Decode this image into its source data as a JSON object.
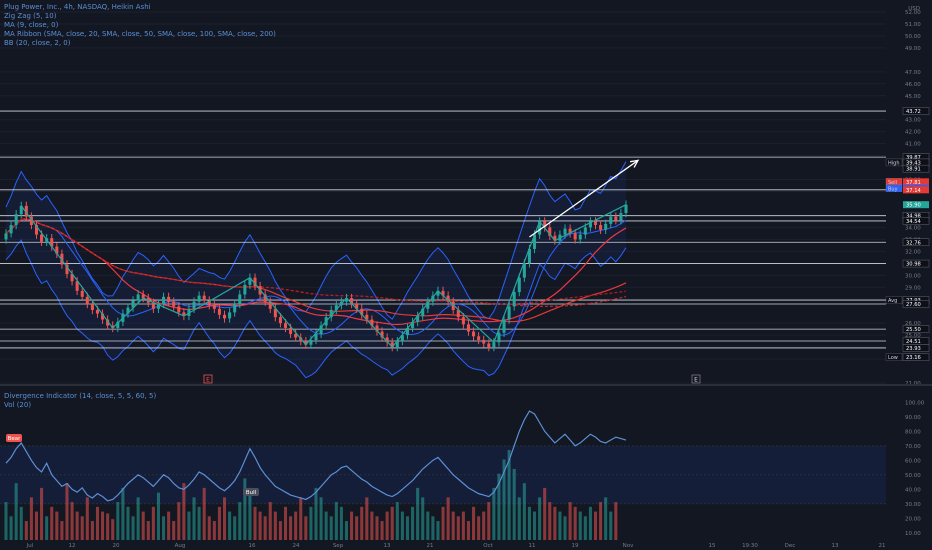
{
  "legend_top": [
    "Plug Power, Inc., 4h, NASDAQ, Heikin Ashi",
    "Zig Zag (5, 10)",
    "MA (9, close, 0)",
    "MA Ribbon (SMA, close, 20, SMA, close, 50, SMA, close, 100, SMA, close, 200)",
    "BB (20, close, 2, 0)"
  ],
  "legend_bottom": [
    "Divergence Indicator (14, close, 5, 5, 60, 5)",
    "Vol (20)"
  ],
  "colors": {
    "background": "#131722",
    "bull": "#26a69a",
    "bear": "#ef5350",
    "bb": "#2962ff",
    "accent_blue": "#5b8fd6",
    "grid": "#2a2e39",
    "label_dark": "#2a2e39",
    "label_red": "#e53935",
    "label_blue": "#2962ff",
    "label_teal": "#26a69a"
  },
  "chart_data": {
    "type": "candlestick",
    "price_unit": "USD",
    "price_axis_ticks": [
      "52.00",
      "51.00",
      "50.00",
      "49.00",
      "47.00",
      "46.00",
      "45.00",
      "43.00",
      "42.00",
      "41.00",
      "40.00",
      "38.00",
      "37.00",
      "35.00",
      "34.00",
      "33.00",
      "32.00",
      "30.00",
      "29.00",
      "28.00",
      "26.00",
      "25.00",
      "24.00",
      "23.00",
      "21.00"
    ],
    "price_tick_values": [
      52,
      51,
      50,
      49,
      47,
      46,
      45,
      43,
      42,
      41,
      40,
      38,
      37,
      35,
      34,
      33,
      32,
      30,
      29,
      28,
      26,
      25,
      24,
      23,
      21
    ],
    "price_range": [
      21.0,
      52.5
    ],
    "time_axis_ticks": [
      "Jul",
      "12",
      "20",
      "Aug",
      "16",
      "24",
      "Sep",
      "13",
      "21",
      "Oct",
      "11",
      "19",
      "Nov",
      "15",
      "19:30",
      "Dec",
      "13",
      "21"
    ],
    "horizontal_levels": [
      43.72,
      39.87,
      37.14,
      34.98,
      34.54,
      32.76,
      30.98,
      27.93,
      27.6,
      25.5,
      24.51,
      23.93
    ],
    "price_labels": [
      {
        "text": "43.72",
        "value": 43.72,
        "tag": "",
        "color": "dark"
      },
      {
        "text": "39.87",
        "value": 39.87,
        "tag": "",
        "color": "dark"
      },
      {
        "text": "39.43",
        "value": 39.43,
        "tag": "High",
        "color": "dark"
      },
      {
        "text": "38.91",
        "value": 38.91,
        "tag": "",
        "color": "dark"
      },
      {
        "text": "37.81",
        "value": 37.81,
        "tag": "Sell",
        "color": "red"
      },
      {
        "text": "37.27",
        "value": 37.27,
        "tag": "Buy",
        "color": "blue"
      },
      {
        "text": "37.14",
        "value": 37.14,
        "tag": "",
        "color": "red"
      },
      {
        "text": "35.90",
        "value": 35.9,
        "tag": "",
        "color": "teal"
      },
      {
        "text": "34.98",
        "value": 34.98,
        "tag": "",
        "color": "dark"
      },
      {
        "text": "34.54",
        "value": 34.54,
        "tag": "",
        "color": "dark"
      },
      {
        "text": "32.76",
        "value": 32.76,
        "tag": "",
        "color": "dark"
      },
      {
        "text": "30.98",
        "value": 30.98,
        "tag": "",
        "color": "dark"
      },
      {
        "text": "27.93",
        "value": 27.93,
        "tag": "Avg",
        "color": "dark"
      },
      {
        "text": "27.60",
        "value": 27.6,
        "tag": "",
        "color": "dark"
      },
      {
        "text": "25.50",
        "value": 25.5,
        "tag": "",
        "color": "dark"
      },
      {
        "text": "24.51",
        "value": 24.51,
        "tag": "",
        "color": "dark"
      },
      {
        "text": "23.93",
        "value": 23.93,
        "tag": "",
        "color": "dark"
      },
      {
        "text": "23.16",
        "value": 23.16,
        "tag": "Low",
        "color": "dark"
      }
    ],
    "series_close": [
      33.5,
      34.2,
      35.1,
      35.8,
      34.9,
      34.2,
      33.4,
      32.8,
      33.1,
      32.4,
      31.8,
      30.9,
      30.1,
      29.5,
      28.7,
      28.2,
      27.6,
      27.1,
      26.8,
      26.3,
      25.8,
      25.6,
      26.1,
      26.8,
      27.3,
      27.9,
      28.4,
      28.1,
      27.7,
      27.2,
      27.6,
      28.2,
      27.8,
      27.4,
      26.9,
      26.6,
      27.2,
      27.8,
      28.3,
      27.9,
      27.5,
      27.2,
      26.7,
      26.4,
      26.9,
      27.6,
      28.4,
      29.2,
      29.8,
      29.1,
      28.4,
      27.8,
      27.2,
      26.5,
      26.0,
      25.6,
      25.1,
      24.8,
      24.5,
      24.2,
      24.6,
      25.1,
      25.8,
      26.5,
      27.1,
      27.5,
      27.8,
      28.1,
      27.6,
      27.2,
      26.7,
      26.3,
      25.8,
      25.3,
      24.8,
      24.4,
      24.0,
      24.5,
      25.0,
      25.6,
      26.1,
      26.6,
      27.2,
      27.8,
      28.3,
      28.7,
      28.3,
      27.8,
      27.1,
      26.5,
      25.9,
      25.3,
      24.9,
      24.6,
      24.3,
      24.0,
      24.4,
      25.2,
      26.3,
      27.4,
      28.6,
      29.8,
      31.0,
      32.2,
      33.4,
      34.5,
      34.0,
      33.3,
      32.9,
      33.4,
      33.9,
      33.5,
      33.0,
      33.4,
      34.0,
      34.5,
      34.2,
      33.8,
      34.3,
      34.9,
      34.6,
      35.2,
      35.9
    ],
    "series_open": [
      33.0,
      33.5,
      34.2,
      35.1,
      35.8,
      34.9,
      34.2,
      33.4,
      32.8,
      33.1,
      32.4,
      31.8,
      30.9,
      30.1,
      29.5,
      28.7,
      28.2,
      27.6,
      27.1,
      26.8,
      26.3,
      25.8,
      25.6,
      26.1,
      26.8,
      27.3,
      27.9,
      28.4,
      28.1,
      27.7,
      27.2,
      27.6,
      28.2,
      27.8,
      27.4,
      26.9,
      26.6,
      27.2,
      27.8,
      28.3,
      27.9,
      27.5,
      27.2,
      26.7,
      26.4,
      26.9,
      27.6,
      28.4,
      29.2,
      29.8,
      29.1,
      28.4,
      27.8,
      27.2,
      26.5,
      26.0,
      25.6,
      25.1,
      24.8,
      24.5,
      24.2,
      24.6,
      25.1,
      25.8,
      26.5,
      27.1,
      27.5,
      27.8,
      28.1,
      27.6,
      27.2,
      26.7,
      26.3,
      25.8,
      25.3,
      24.8,
      24.4,
      24.0,
      24.5,
      25.0,
      25.6,
      26.1,
      26.6,
      27.2,
      27.8,
      28.3,
      28.7,
      28.3,
      27.8,
      27.1,
      26.5,
      25.9,
      25.3,
      24.9,
      24.6,
      24.3,
      24.0,
      24.4,
      25.2,
      26.3,
      27.4,
      28.6,
      29.8,
      31.0,
      32.2,
      33.4,
      34.5,
      34.0,
      33.3,
      32.9,
      33.4,
      33.9,
      33.5,
      33.0,
      33.4,
      34.0,
      34.5,
      34.2,
      33.8,
      34.3,
      34.9,
      34.6,
      35.2
    ],
    "oscillator_axis_ticks": [
      "100.00",
      "90.00",
      "80.00",
      "70.00",
      "60.00",
      "50.00",
      "40.00",
      "30.00",
      "20.00",
      "10.00"
    ],
    "oscillator_tick_values": [
      100,
      90,
      80,
      70,
      60,
      50,
      40,
      30,
      20,
      10
    ],
    "oscillator_range": [
      5,
      103
    ],
    "oscillator_bands": [
      30,
      70
    ],
    "oscillator_values": [
      58,
      62,
      68,
      72,
      66,
      60,
      55,
      52,
      58,
      50,
      46,
      42,
      44,
      40,
      38,
      41,
      36,
      34,
      37,
      35,
      32,
      33,
      36,
      40,
      44,
      47,
      50,
      48,
      45,
      42,
      46,
      50,
      48,
      44,
      41,
      40,
      43,
      47,
      52,
      50,
      47,
      44,
      41,
      39,
      42,
      46,
      52,
      60,
      68,
      62,
      55,
      50,
      46,
      42,
      40,
      38,
      36,
      35,
      34,
      33,
      35,
      38,
      42,
      46,
      50,
      52,
      55,
      56,
      53,
      50,
      47,
      45,
      42,
      40,
      38,
      36,
      35,
      37,
      40,
      43,
      46,
      50,
      54,
      57,
      60,
      62,
      58,
      54,
      50,
      47,
      44,
      41,
      39,
      37,
      36,
      35,
      38,
      44,
      52,
      60,
      70,
      80,
      88,
      94,
      92,
      86,
      80,
      76,
      72,
      75,
      78,
      74,
      70,
      72,
      75,
      78,
      76,
      73,
      72,
      74,
      76,
      75,
      74
    ],
    "divergence_labels": [
      "Bear",
      "Bull"
    ],
    "volume_values": [
      40,
      25,
      60,
      35,
      20,
      45,
      30,
      55,
      25,
      35,
      30,
      20,
      60,
      40,
      30,
      25,
      45,
      20,
      35,
      30,
      28,
      22,
      40,
      55,
      35,
      25,
      45,
      30,
      20,
      35,
      50,
      25,
      30,
      20,
      40,
      60,
      30,
      45,
      35,
      55,
      25,
      20,
      35,
      45,
      30,
      25,
      40,
      65,
      55,
      35,
      30,
      25,
      40,
      30,
      20,
      35,
      25,
      30,
      45,
      25,
      35,
      55,
      45,
      30,
      25,
      40,
      35,
      20,
      30,
      25,
      35,
      45,
      30,
      25,
      20,
      30,
      35,
      40,
      30,
      25,
      35,
      55,
      45,
      30,
      25,
      20,
      35,
      45,
      30,
      25,
      30,
      20,
      35,
      25,
      30,
      40,
      55,
      70,
      85,
      95,
      75,
      45,
      60,
      35,
      30,
      45,
      55,
      40,
      35,
      30,
      25,
      40,
      35,
      30,
      25,
      35,
      30,
      40,
      45,
      30,
      40
    ]
  }
}
